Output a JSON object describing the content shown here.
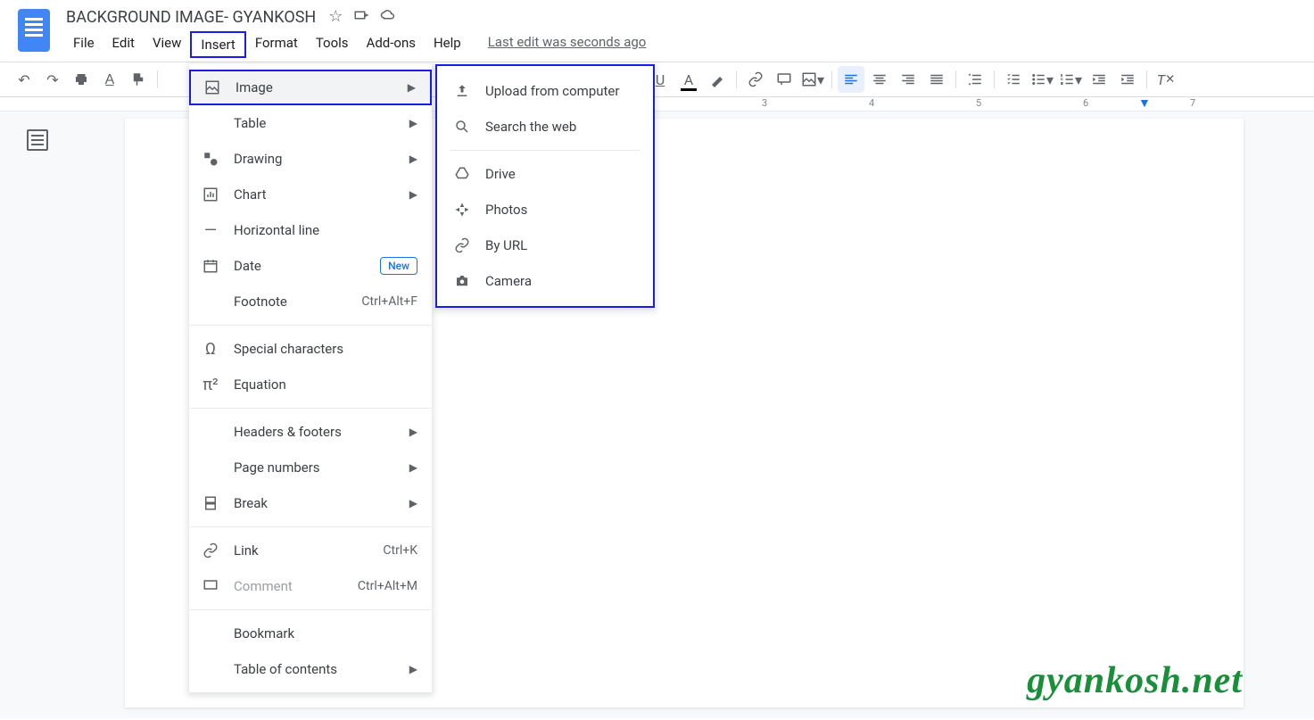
{
  "title": "BACKGROUND IMAGE- GYANKOSH",
  "menu": {
    "file": "File",
    "edit": "Edit",
    "view": "View",
    "insert": "Insert",
    "format": "Format",
    "tools": "Tools",
    "addons": "Add-ons",
    "help": "Help"
  },
  "last_edit": "Last edit was seconds ago",
  "insert_menu": {
    "image": "Image",
    "table": "Table",
    "drawing": "Drawing",
    "chart": "Chart",
    "horizontal_line": "Horizontal line",
    "date": "Date",
    "date_badge": "New",
    "footnote": "Footnote",
    "footnote_sc": "Ctrl+Alt+F",
    "special_chars": "Special characters",
    "equation": "Equation",
    "headers_footers": "Headers & footers",
    "page_numbers": "Page numbers",
    "break": "Break",
    "link": "Link",
    "link_sc": "Ctrl+K",
    "comment": "Comment",
    "comment_sc": "Ctrl+Alt+M",
    "bookmark": "Bookmark",
    "toc": "Table of contents"
  },
  "image_submenu": {
    "upload": "Upload from computer",
    "search": "Search the web",
    "drive": "Drive",
    "photos": "Photos",
    "url": "By URL",
    "camera": "Camera"
  },
  "ruler": {
    "r3": "3",
    "r4": "4",
    "r5": "5",
    "r6": "6",
    "r7": "7"
  },
  "watermark": "gyankosh.net"
}
